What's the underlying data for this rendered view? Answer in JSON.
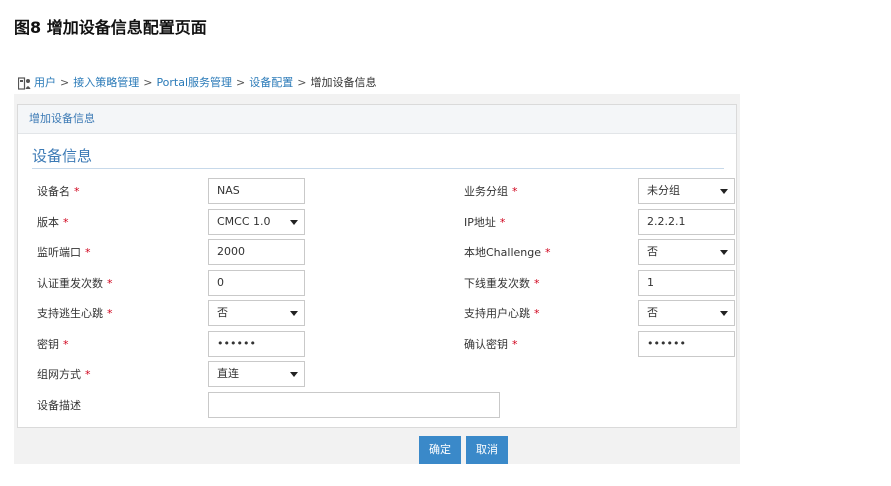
{
  "caption": "图8 增加设备信息配置页面",
  "breadcrumb": {
    "icon": "user-access-icon",
    "items": [
      "用户",
      "接入策略管理",
      "Portal服务管理",
      "设备配置"
    ],
    "separator": ">",
    "current": "增加设备信息"
  },
  "panel": {
    "header": "增加设备信息",
    "section_title": "设备信息"
  },
  "required_mark": "*",
  "form": {
    "device_name": {
      "label": "设备名",
      "value": "NAS"
    },
    "version": {
      "label": "版本",
      "value": "CMCC 1.0"
    },
    "listen_port": {
      "label": "监听端口",
      "value": "2000"
    },
    "auth_retry": {
      "label": "认证重发次数",
      "value": "0"
    },
    "escape_heartbeat": {
      "label": "支持逃生心跳",
      "value": "否"
    },
    "secret_key": {
      "label": "密钥",
      "value": "••••••"
    },
    "network_mode": {
      "label": "组网方式",
      "value": "直连"
    },
    "description": {
      "label": "设备描述",
      "value": ""
    },
    "service_group": {
      "label": "业务分组",
      "value": "未分组"
    },
    "ip_address": {
      "label": "IP地址",
      "value": "2.2.2.1"
    },
    "local_challenge": {
      "label": "本地Challenge",
      "value": "否"
    },
    "offline_retry": {
      "label": "下线重发次数",
      "value": "1"
    },
    "user_heartbeat": {
      "label": "支持用户心跳",
      "value": "否"
    },
    "confirm_key": {
      "label": "确认密钥",
      "value": "••••••"
    }
  },
  "buttons": {
    "ok": "确定",
    "cancel": "取消"
  },
  "colors": {
    "accent": "#3c7ab5",
    "button": "#3a89c9",
    "required": "#d0021b"
  }
}
